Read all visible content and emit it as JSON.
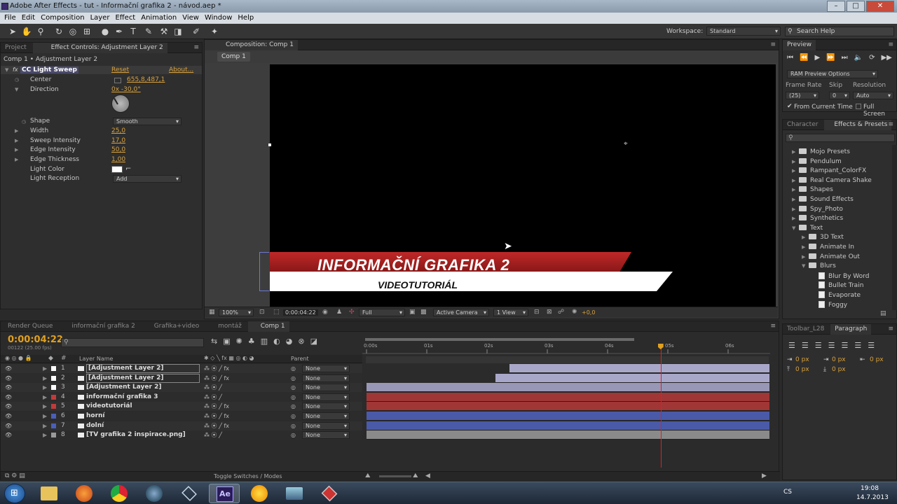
{
  "window": {
    "title": "Adobe After Effects - tut - Informační grafika 2 - návod.aep *"
  },
  "menu": [
    "File",
    "Edit",
    "Composition",
    "Layer",
    "Effect",
    "Animation",
    "View",
    "Window",
    "Help"
  ],
  "toolbar": {
    "workspace_label": "Workspace:",
    "workspace_value": "Standard",
    "search_placeholder": "Search Help"
  },
  "left_panel": {
    "tabs": [
      "Project",
      "Effect Controls: Adjustment Layer 2"
    ],
    "breadcrumb": "Comp 1 • Adjustment Layer 2",
    "effect_name": "CC Light Sweep",
    "reset": "Reset",
    "about": "About...",
    "props": [
      {
        "name": "Center",
        "value": "655,8,487,1"
      },
      {
        "name": "Direction",
        "value": "0x -30,0°"
      },
      {
        "name": "Shape",
        "value": "Smooth"
      },
      {
        "name": "Width",
        "value": "25,0"
      },
      {
        "name": "Sweep Intensity",
        "value": "17,0"
      },
      {
        "name": "Edge Intensity",
        "value": "50,0"
      },
      {
        "name": "Edge Thickness",
        "value": "1,00"
      },
      {
        "name": "Light Color",
        "value": ""
      },
      {
        "name": "Light Reception",
        "value": "Add"
      }
    ]
  },
  "comp_panel": {
    "tab": "Composition: Comp 1",
    "subtab": "Comp 1",
    "title_text": "INFORMAČNÍ GRAFIKA 2",
    "subtitle_text": "VIDEOTUTORIÁL",
    "footer": {
      "zoom": "100%",
      "timecode": "0:00:04:22",
      "resolution": "Full",
      "camera": "Active Camera",
      "view": "1 View",
      "exposure": "+0,0"
    }
  },
  "preview_panel": {
    "tab": "Preview",
    "ram_options": "RAM Preview Options",
    "frame_rate_label": "Frame Rate",
    "skip_label": "Skip",
    "resolution_label": "Resolution",
    "frame_rate_value": "(25)",
    "skip_value": "0",
    "resolution_value": "Auto",
    "from_current": "From Current Time",
    "full_screen": "Full Screen"
  },
  "effects_panel": {
    "tabs": [
      "Character",
      "Effects & Presets"
    ],
    "items": [
      {
        "label": "Mojo Presets",
        "type": "folder",
        "indent": 0
      },
      {
        "label": "Pendulum",
        "type": "folder",
        "indent": 0
      },
      {
        "label": "Rampant_ColorFX",
        "type": "folder",
        "indent": 0
      },
      {
        "label": "Real Camera Shake",
        "type": "folder",
        "indent": 0
      },
      {
        "label": "Shapes",
        "type": "folder",
        "indent": 0
      },
      {
        "label": "Sound Effects",
        "type": "folder",
        "indent": 0
      },
      {
        "label": "Spy_Photo",
        "type": "folder",
        "indent": 0
      },
      {
        "label": "Synthetics",
        "type": "folder",
        "indent": 0
      },
      {
        "label": "Text",
        "type": "folder",
        "indent": 0
      },
      {
        "label": "3D Text",
        "type": "folder",
        "indent": 1
      },
      {
        "label": "Animate In",
        "type": "folder",
        "indent": 1
      },
      {
        "label": "Animate Out",
        "type": "folder",
        "indent": 1
      },
      {
        "label": "Blurs",
        "type": "folder",
        "indent": 1
      },
      {
        "label": "Blur By Word",
        "type": "preset",
        "indent": 2
      },
      {
        "label": "Bullet Train",
        "type": "preset",
        "indent": 2
      },
      {
        "label": "Evaporate",
        "type": "preset",
        "indent": 2
      },
      {
        "label": "Foggy",
        "type": "preset",
        "indent": 2
      }
    ]
  },
  "paragraph_panel": {
    "tabs": [
      "Toolbar_L28",
      "Paragraph"
    ],
    "values": [
      "0 px",
      "0 px",
      "0 px",
      "0 px",
      "0 px"
    ]
  },
  "timeline": {
    "tabs": [
      "Render Queue",
      "informační grafika 2",
      "Grafika+video",
      "montáž",
      "Comp 1"
    ],
    "timecode": "0:00:04:22",
    "frames": "00122 (25.00 fps)",
    "col_layer_name": "Layer Name",
    "col_parent": "Parent",
    "ruler": [
      "0:00s",
      "01s",
      "02s",
      "03s",
      "04s",
      "05s",
      "06s"
    ],
    "toggle_label": "Toggle Switches / Modes",
    "layers": [
      {
        "num": "1",
        "name": "[Adjustment Layer 2]",
        "parent": "None",
        "label_color": "#ffffff",
        "bar_color": "#a9a7c9",
        "bar_start": 2.38,
        "selected": true,
        "fx": true
      },
      {
        "num": "2",
        "name": "[Adjustment Layer 2]",
        "parent": "None",
        "label_color": "#ffffff",
        "bar_color": "#a9a7c9",
        "bar_start": 2.14,
        "selected": true,
        "fx": true
      },
      {
        "num": "3",
        "name": "[Adjustment Layer 2]",
        "parent": "None",
        "label_color": "#ffffff",
        "bar_color": "#9897b5",
        "bar_start": 0,
        "selected": false,
        "fx": false
      },
      {
        "num": "4",
        "name": "informační grafika 3",
        "parent": "None",
        "label_color": "#c23b3b",
        "bar_color": "#a13636",
        "bar_start": 0,
        "selected": false,
        "fx": false
      },
      {
        "num": "5",
        "name": "videotutoriál",
        "parent": "None",
        "label_color": "#c23b3b",
        "bar_color": "#a13636",
        "bar_start": 0,
        "selected": false,
        "fx": true
      },
      {
        "num": "6",
        "name": "horní",
        "parent": "None",
        "label_color": "#4b5fb8",
        "bar_color": "#4a5aa8",
        "bar_start": 0,
        "selected": false,
        "fx": true
      },
      {
        "num": "7",
        "name": "dolní",
        "parent": "None",
        "label_color": "#4b5fb8",
        "bar_color": "#4a5aa8",
        "bar_start": 0,
        "selected": false,
        "fx": true
      },
      {
        "num": "8",
        "name": "[TV grafika 2 inspirace.png]",
        "parent": "None",
        "label_color": "#9a9a9a",
        "bar_color": "#8a8a8a",
        "bar_start": 0,
        "selected": false,
        "fx": false
      }
    ],
    "playhead_seconds": 4.88,
    "total_seconds": 6.7
  },
  "taskbar": {
    "lang": "CS",
    "time": "19:08",
    "date": "14.7.2013"
  }
}
